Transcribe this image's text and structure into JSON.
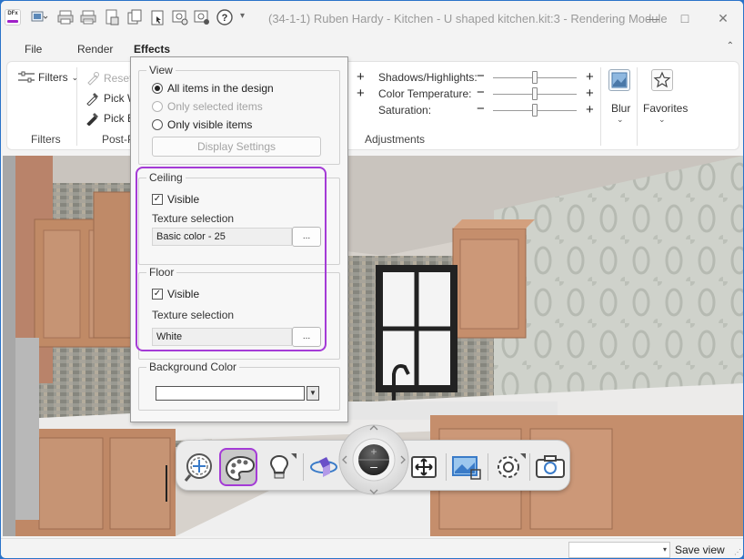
{
  "app": {
    "logo_text": "DFx",
    "title": "(34-1-1) Ruben Hardy - Kitchen - U shaped kitchen.kit:3 - Rendering Module",
    "qat_overflow": "▾",
    "window_controls": {
      "minimize": "—",
      "maximize": "□",
      "close": "✕"
    }
  },
  "quick_access": [
    "display-dropdown-icon",
    "print-icon",
    "print-preview-icon",
    "export-icon",
    "copy-icon",
    "paste-icon",
    "render-settings-icon",
    "settings-icon",
    "help-icon"
  ],
  "tabs": [
    {
      "label": "File",
      "active": false
    },
    {
      "label": "Render",
      "active": false
    },
    {
      "label": "Effects",
      "active": true
    }
  ],
  "ribbon": {
    "filters": {
      "button": "Filters",
      "group": "Filters"
    },
    "post": {
      "reset": "Reset",
      "pick_w": "Pick W",
      "pick_b": "Pick Bl",
      "group": "Post-P"
    },
    "adjustments": {
      "group": "Adjustments",
      "plus": "+",
      "minus": "−",
      "sliders": [
        {
          "label": "Shadows/Highlights:",
          "value": 0.5
        },
        {
          "label": "Color Temperature:",
          "value": 0.5
        },
        {
          "label": "Saturation:",
          "value": 0.5
        }
      ]
    },
    "blur": "Blur",
    "favorites": "Favorites",
    "caret": "⌄"
  },
  "panel": {
    "view": {
      "title": "View",
      "options": [
        {
          "label": "All items in the design",
          "selected": true,
          "enabled": true
        },
        {
          "label": "Only selected items",
          "selected": false,
          "enabled": false
        },
        {
          "label": "Only visible items",
          "selected": false,
          "enabled": true
        }
      ],
      "display_settings": "Display Settings"
    },
    "ceiling": {
      "title": "Ceiling",
      "visible_label": "Visible",
      "visible": true,
      "texture_label": "Texture selection",
      "texture_value": "Basic color - 25",
      "browse": "..."
    },
    "floor": {
      "title": "Floor",
      "visible_label": "Visible",
      "visible": true,
      "texture_label": "Texture selection",
      "texture_value": "White",
      "browse": "..."
    },
    "background": {
      "title": "Background Color",
      "color": "#ffffff"
    },
    "check_mark": "✓"
  },
  "toolbar": {
    "buttons": [
      "zoom-pan-icon",
      "palette-icon",
      "lighting-icon",
      "orbit-icon",
      "fit-view-icon",
      "image-crop-icon",
      "settings-gear-icon",
      "camera-icon"
    ],
    "active": "palette-icon"
  },
  "status": {
    "view_value": "",
    "view_caret": "▾",
    "save_view": "Save view",
    "grip": "⋰"
  },
  "colors": {
    "accent": "#a43bd6",
    "window_border": "#2a73c9",
    "cabinet": "#c08a66"
  }
}
